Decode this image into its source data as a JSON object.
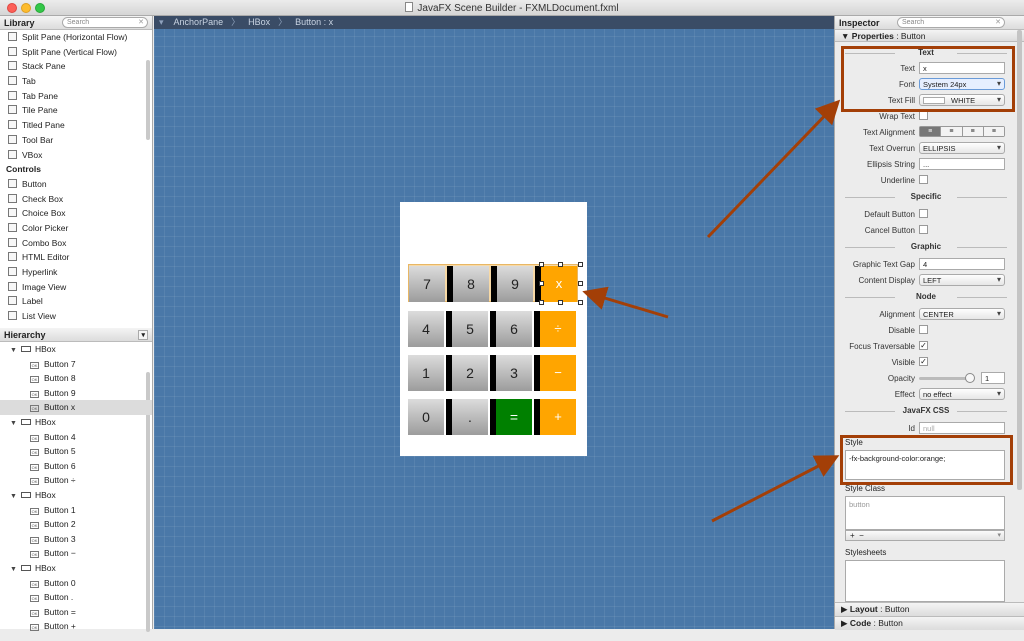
{
  "window": {
    "title": "JavaFX Scene Builder - FXMLDocument.fxml"
  },
  "library": {
    "title": "Library",
    "search_placeholder": "Search",
    "items": [
      {
        "label": "Split Pane (Horizontal Flow)",
        "icon": "split-pane-icon"
      },
      {
        "label": "Split Pane (Vertical Flow)",
        "icon": "split-pane-icon"
      },
      {
        "label": "Stack Pane",
        "icon": "stack-pane-icon"
      },
      {
        "label": "Tab",
        "icon": "tab-icon"
      },
      {
        "label": "Tab Pane",
        "icon": "tab-pane-icon"
      },
      {
        "label": "Tile Pane",
        "icon": "tile-pane-icon"
      },
      {
        "label": "Titled Pane",
        "icon": "titled-pane-icon"
      },
      {
        "label": "Tool Bar",
        "icon": "tool-bar-icon"
      },
      {
        "label": "VBox",
        "icon": "vbox-icon"
      }
    ],
    "controls_title": "Controls",
    "controls": [
      {
        "label": "Button",
        "icon": "button-icon"
      },
      {
        "label": "Check Box",
        "icon": "check-box-icon"
      },
      {
        "label": "Choice Box",
        "icon": "choice-box-icon"
      },
      {
        "label": "Color Picker",
        "icon": "color-picker-icon"
      },
      {
        "label": "Combo Box",
        "icon": "combo-box-icon"
      },
      {
        "label": "HTML Editor",
        "icon": "html-editor-icon"
      },
      {
        "label": "Hyperlink",
        "icon": "hyperlink-icon"
      },
      {
        "label": "Image View",
        "icon": "image-view-icon"
      },
      {
        "label": "Label",
        "icon": "label-icon"
      },
      {
        "label": "List View",
        "icon": "list-view-icon"
      }
    ]
  },
  "hierarchy": {
    "title": "Hierarchy",
    "rows": [
      {
        "kind": "hbox",
        "label": "HBox"
      },
      {
        "kind": "button",
        "label": "Button 7"
      },
      {
        "kind": "button",
        "label": "Button 8"
      },
      {
        "kind": "button",
        "label": "Button 9"
      },
      {
        "kind": "button",
        "label": "Button x",
        "selected": true
      },
      {
        "kind": "hbox",
        "label": "HBox"
      },
      {
        "kind": "button",
        "label": "Button 4"
      },
      {
        "kind": "button",
        "label": "Button 5"
      },
      {
        "kind": "button",
        "label": "Button 6"
      },
      {
        "kind": "button",
        "label": "Button ÷"
      },
      {
        "kind": "hbox",
        "label": "HBox"
      },
      {
        "kind": "button",
        "label": "Button 1"
      },
      {
        "kind": "button",
        "label": "Button 2"
      },
      {
        "kind": "button",
        "label": "Button 3"
      },
      {
        "kind": "button",
        "label": "Button −"
      },
      {
        "kind": "hbox",
        "label": "HBox"
      },
      {
        "kind": "button",
        "label": "Button 0"
      },
      {
        "kind": "button",
        "label": "Button ."
      },
      {
        "kind": "button",
        "label": "Button ="
      },
      {
        "kind": "button",
        "label": "Button +"
      }
    ]
  },
  "breadcrumb": [
    "AnchorPane",
    "HBox",
    "Button : x"
  ],
  "calculator": {
    "rows": [
      [
        "7",
        "8",
        "9",
        "x"
      ],
      [
        "4",
        "5",
        "6",
        "÷"
      ],
      [
        "1",
        "2",
        "3",
        "−"
      ],
      [
        "0",
        ".",
        "=",
        "+"
      ]
    ],
    "orange_keys": [
      "x",
      "÷",
      "−",
      "+"
    ],
    "green_keys": [
      "="
    ],
    "selected_key": "x",
    "colors": {
      "orange": "#ffa500",
      "green": "#008000",
      "canvas": "#4a78a8"
    }
  },
  "inspector": {
    "title": "Inspector",
    "search_placeholder": "Search",
    "properties_label": "Properties",
    "properties_target": "Button",
    "groups": {
      "text": "Text",
      "specific": "Specific",
      "graphic": "Graphic",
      "node": "Node",
      "css": "JavaFX CSS"
    },
    "text": {
      "text_label": "Text",
      "text_value": "x",
      "font_label": "Font",
      "font_value": "System 24px",
      "fill_label": "Text Fill",
      "fill_value": "WHITE",
      "wrap_label": "Wrap Text",
      "alignment_label": "Text Alignment",
      "overrun_label": "Text Overrun",
      "overrun_value": "ELLIPSIS",
      "ellipsis_label": "Ellipsis String",
      "ellipsis_value": "...",
      "underline_label": "Underline"
    },
    "specific": {
      "default_label": "Default Button",
      "cancel_label": "Cancel Button"
    },
    "graphic": {
      "gap_label": "Graphic Text Gap",
      "gap_value": "4",
      "display_label": "Content Display",
      "display_value": "LEFT"
    },
    "node": {
      "alignment_label": "Alignment",
      "alignment_value": "CENTER",
      "disable_label": "Disable",
      "focus_label": "Focus Traversable",
      "focus_checked": true,
      "visible_label": "Visible",
      "visible_checked": true,
      "opacity_label": "Opacity",
      "opacity_value": "1",
      "effect_label": "Effect",
      "effect_value": "no effect"
    },
    "css": {
      "id_label": "Id",
      "id_placeholder": "null",
      "style_label": "Style",
      "style_value": "-fx-background-color:orange;",
      "style_class_label": "Style Class",
      "style_class_value": "button",
      "stylesheets_label": "Stylesheets"
    },
    "layout_label": "Layout",
    "layout_target": "Button",
    "code_label": "Code",
    "code_target": "Button"
  },
  "annotation_color": "#a33f07"
}
